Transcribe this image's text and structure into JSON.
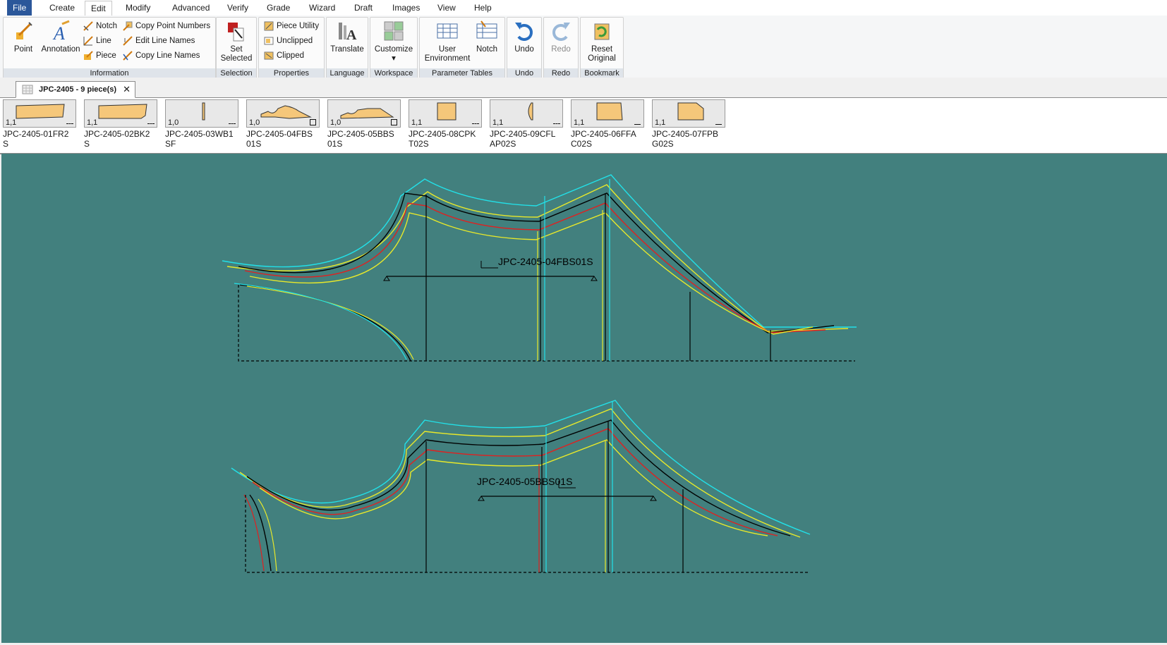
{
  "menu": {
    "items": [
      "File",
      "Create",
      "Edit",
      "Modify",
      "Advanced",
      "Verify",
      "Grade",
      "Wizard",
      "Draft",
      "Images",
      "View",
      "Help"
    ],
    "active": "Edit"
  },
  "ribbon": {
    "information": {
      "label": "Information",
      "point": "Point",
      "annotation": "Annotation",
      "notch": "Notch",
      "line": "Line",
      "piece": "Piece",
      "copy_point_numbers": "Copy Point Numbers",
      "edit_line_names": "Edit Line Names",
      "copy_line_names": "Copy Line Names"
    },
    "selection": {
      "label": "Selection",
      "set_selected_1": "Set",
      "set_selected_2": "Selected"
    },
    "properties": {
      "label": "Properties",
      "piece_utility": "Piece Utility",
      "unclipped": "Unclipped",
      "clipped": "Clipped"
    },
    "language": {
      "label": "Language",
      "translate": "Translate"
    },
    "workspace": {
      "label": "Workspace",
      "customize": "Customize"
    },
    "parameter_tables": {
      "label": "Parameter Tables",
      "user_env_1": "User",
      "user_env_2": "Environment",
      "notch": "Notch"
    },
    "undo": {
      "label": "Undo",
      "button": "Undo"
    },
    "redo": {
      "label": "Redo",
      "button": "Redo"
    },
    "bookmark": {
      "label": "Bookmark",
      "reset_1": "Reset",
      "reset_2": "Original"
    }
  },
  "document_tab": {
    "title": "JPC-2405  -  9 piece(s)",
    "close": "✕"
  },
  "pieces": [
    {
      "name_1": "JPC-2405-01FR2",
      "name_2": "S",
      "qty": "1,1"
    },
    {
      "name_1": "JPC-2405-02BK2",
      "name_2": "S",
      "qty": "1,1"
    },
    {
      "name_1": "JPC-2405-03WB1",
      "name_2": "SF",
      "qty": "1,0"
    },
    {
      "name_1": "JPC-2405-04FBS",
      "name_2": "01S",
      "qty": "1,0"
    },
    {
      "name_1": "JPC-2405-05BBS",
      "name_2": "01S",
      "qty": "1,0"
    },
    {
      "name_1": "JPC-2405-08CPK",
      "name_2": "T02S",
      "qty": "1,1"
    },
    {
      "name_1": "JPC-2405-09CFL",
      "name_2": "AP02S",
      "qty": "1,1"
    },
    {
      "name_1": "JPC-2405-06FFA",
      "name_2": "C02S",
      "qty": "1,1"
    },
    {
      "name_1": "JPC-2405-07FPB",
      "name_2": "G02S",
      "qty": "1,1"
    }
  ],
  "canvas": {
    "background": "#42807e",
    "piece_labels": [
      "JPC-2405-04FBS01S",
      "JPC-2405-05BBS01S"
    ],
    "grade_colors": [
      "#000000",
      "#e8e82a",
      "#e02020",
      "#22e0e8"
    ]
  }
}
